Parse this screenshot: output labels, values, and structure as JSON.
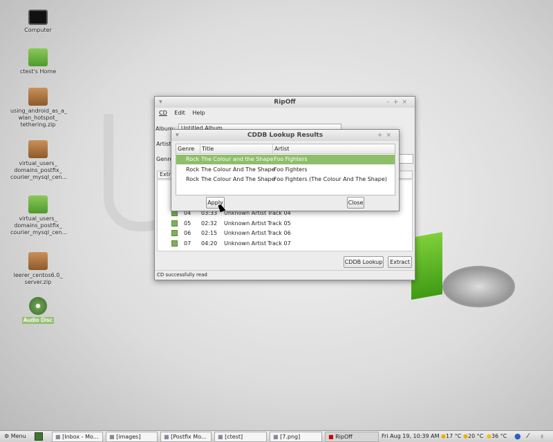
{
  "desktop": {
    "icons": [
      {
        "label": "Computer",
        "type": "computer"
      },
      {
        "label": "ctest's Home",
        "type": "home"
      },
      {
        "label": "using_android_as_a_\nwlan_hotspot_\ntethering.zip",
        "type": "zip"
      },
      {
        "label": "virtual_users_\ndomains_postfix_\ncourier_mysql_cen...",
        "type": "zip"
      },
      {
        "label": "virtual_users_\ndomains_postfix_\ncourier_mysql_cen...",
        "type": "folder"
      },
      {
        "label": "leerer_centos6.0_\nserver.zip",
        "type": "zip"
      },
      {
        "label": "Audio Disc",
        "type": "disc"
      }
    ]
  },
  "ripoff": {
    "title": "RipOff",
    "menu": [
      "CD",
      "Edit",
      "Help"
    ],
    "album_label": "Album:",
    "album_value": "Untitled Album",
    "artist_label": "Artist",
    "genre_label": "Genre",
    "tab_label": "Extra",
    "tracks": [
      {
        "num": "04",
        "time": "03:33",
        "artist": "Unknown Artist",
        "title": "Track 04"
      },
      {
        "num": "05",
        "time": "02:32",
        "artist": "Unknown Artist",
        "title": "Track 05"
      },
      {
        "num": "06",
        "time": "02:15",
        "artist": "Unknown Artist",
        "title": "Track 06"
      },
      {
        "num": "07",
        "time": "04:20",
        "artist": "Unknown Artist",
        "title": "Track 07"
      }
    ],
    "cddb_button": "CDDB Lookup",
    "extract_button": "Extract",
    "status": "CD successfully read"
  },
  "dialog": {
    "title": "CDDB Lookup Results",
    "columns": [
      "Genre",
      "Title",
      "Artist"
    ],
    "rows": [
      {
        "genre": "Rock",
        "title": "The Colour and the Shape",
        "artist": "Foo Fighters"
      },
      {
        "genre": "Rock",
        "title": "The Colour And The Shape",
        "artist": "Foo Fighters"
      },
      {
        "genre": "Rock",
        "title": "The Colour And The Shape",
        "artist": "Foo Fighters (The Colour And The Shape)"
      }
    ],
    "apply": "Apply",
    "close": "Close",
    "selected_color": "#8fbe6b"
  },
  "taskbar": {
    "menu": "Menu",
    "tasks": [
      "[Inbox - Mo...",
      "[images]",
      "[Postfix Mo...",
      "[ctest]",
      "[7.png]",
      "RipOff"
    ],
    "clock": "Fri Aug 19, 10:39 AM",
    "temps": [
      "17 °C",
      "20 °C",
      "36 °C"
    ]
  }
}
